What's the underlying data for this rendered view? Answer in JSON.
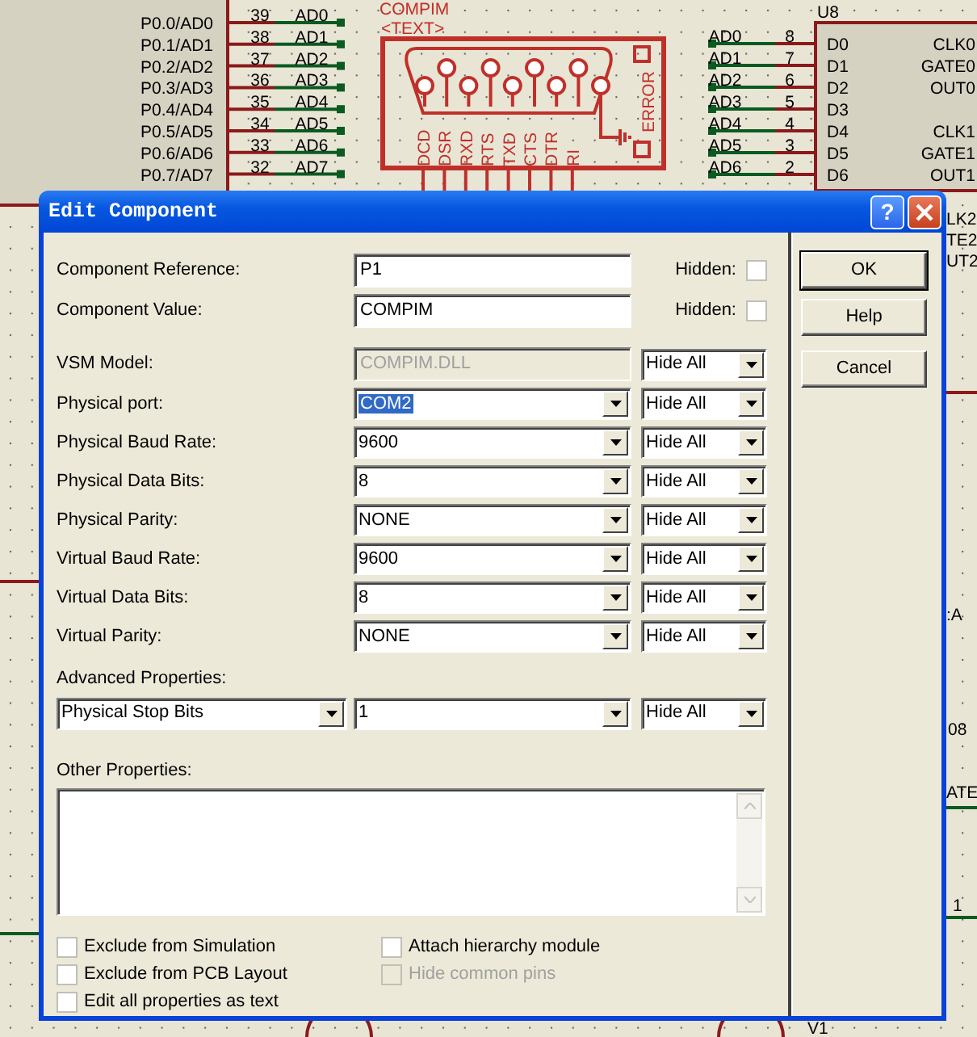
{
  "schematic": {
    "left_chip": {
      "pins": [
        {
          "name": "P0.0/AD0",
          "number": "39",
          "net": "AD0"
        },
        {
          "name": "P0.1/AD1",
          "number": "38",
          "net": "AD1"
        },
        {
          "name": "P0.2/AD2",
          "number": "37",
          "net": "AD2"
        },
        {
          "name": "P0.3/AD3",
          "number": "36",
          "net": "AD3"
        },
        {
          "name": "P0.4/AD4",
          "number": "35",
          "net": "AD4"
        },
        {
          "name": "P0.5/AD5",
          "number": "34",
          "net": "AD5"
        },
        {
          "name": "P0.6/AD6",
          "number": "33",
          "net": "AD6"
        },
        {
          "name": "P0.7/AD7",
          "number": "32",
          "net": "AD7"
        }
      ]
    },
    "connector": {
      "name": "COMPIM",
      "text": "<TEXT>",
      "pins": [
        "DCD",
        "DSR",
        "RXD",
        "RTS",
        "TXD",
        "CTS",
        "DTR",
        "RI"
      ],
      "status_label": "ERROR"
    },
    "right_nets": [
      {
        "net": "AD0",
        "number": "8"
      },
      {
        "net": "AD1",
        "number": "7"
      },
      {
        "net": "AD2",
        "number": "6"
      },
      {
        "net": "AD3",
        "number": "5"
      },
      {
        "net": "AD4",
        "number": "4"
      },
      {
        "net": "AD5",
        "number": "3"
      },
      {
        "net": "AD6",
        "number": "2"
      }
    ],
    "u8": {
      "name": "U8",
      "left_pins": [
        "D0",
        "D1",
        "D2",
        "D3",
        "D4",
        "D5",
        "D6"
      ],
      "right_pin_groups": [
        [
          "CLK0",
          "GATE0",
          "OUT0"
        ],
        [
          "CLK1",
          "GATE1",
          "OUT1"
        ]
      ]
    },
    "fragments": [
      "LK2",
      "TE2",
      "UT2",
      ":A",
      "08",
      "ATE",
      "1",
      "V1"
    ]
  },
  "dialog": {
    "title": "Edit Component",
    "help_glyph": "?",
    "top_fields": [
      {
        "label": "Component Reference:",
        "value": "P1",
        "hidden_label": "Hidden:",
        "hidden": false
      },
      {
        "label": "Component Value:",
        "value": "COMPIM",
        "hidden_label": "Hidden:",
        "hidden": false
      }
    ],
    "properties": [
      {
        "label": "VSM Model:",
        "value": "COMPIM.DLL",
        "kind": "text",
        "disabled": true,
        "highlighted": false,
        "visibility": "Hide All"
      },
      {
        "label": "Physical port:",
        "value": "COM2",
        "kind": "combo",
        "disabled": false,
        "highlighted": true,
        "visibility": "Hide All"
      },
      {
        "label": "Physical Baud Rate:",
        "value": "9600",
        "kind": "combo",
        "disabled": false,
        "highlighted": false,
        "visibility": "Hide All"
      },
      {
        "label": "Physical Data Bits:",
        "value": "8",
        "kind": "combo",
        "disabled": false,
        "highlighted": false,
        "visibility": "Hide All"
      },
      {
        "label": "Physical Parity:",
        "value": "NONE",
        "kind": "combo",
        "disabled": false,
        "highlighted": false,
        "visibility": "Hide All"
      },
      {
        "label": "Virtual Baud Rate:",
        "value": "9600",
        "kind": "combo",
        "disabled": false,
        "highlighted": false,
        "visibility": "Hide All"
      },
      {
        "label": "Virtual Data Bits:",
        "value": "8",
        "kind": "combo",
        "disabled": false,
        "highlighted": false,
        "visibility": "Hide All"
      },
      {
        "label": "Virtual Parity:",
        "value": "NONE",
        "kind": "combo",
        "disabled": false,
        "highlighted": false,
        "visibility": "Hide All"
      }
    ],
    "advanced": {
      "label": "Advanced Properties:",
      "property": "Physical Stop Bits",
      "value": "1",
      "visibility": "Hide All"
    },
    "other": {
      "label": "Other Properties:"
    },
    "options_left": [
      {
        "label": "Exclude from Simulation",
        "checked": false,
        "disabled": false
      },
      {
        "label": "Exclude from PCB Layout",
        "checked": false,
        "disabled": false
      },
      {
        "label": "Edit all properties as text",
        "checked": false,
        "disabled": false
      }
    ],
    "options_right": [
      {
        "label": "Attach hierarchy module",
        "checked": false,
        "disabled": false
      },
      {
        "label": "Hide common pins",
        "checked": false,
        "disabled": true
      }
    ],
    "buttons": [
      {
        "label": "OK",
        "default": true
      },
      {
        "label": "Help",
        "default": false
      },
      {
        "label": "Cancel",
        "default": false
      }
    ]
  }
}
